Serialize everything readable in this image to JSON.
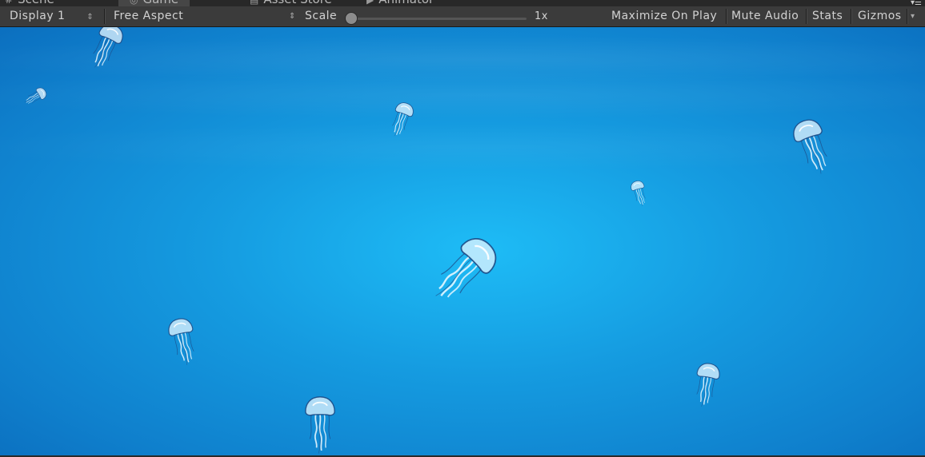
{
  "tabs": [
    {
      "label": "Scene",
      "icon": "scene-icon"
    },
    {
      "label": "Game",
      "icon": "game-icon",
      "active": true
    },
    {
      "label": "Asset Store",
      "icon": "asset-store-icon"
    },
    {
      "label": "Animator",
      "icon": "animator-icon"
    }
  ],
  "toolbar": {
    "display": "Display 1",
    "aspect": "Free Aspect",
    "scale_label": "Scale",
    "scale_value": "1x",
    "maximize": "Maximize On Play",
    "mute": "Mute Audio",
    "stats": "Stats",
    "gizmos": "Gizmos"
  },
  "colors": {
    "toolbar_bg": "#3b3b3b",
    "water_center": "#1ebcf6",
    "water_edge": "#0b6fbf"
  }
}
